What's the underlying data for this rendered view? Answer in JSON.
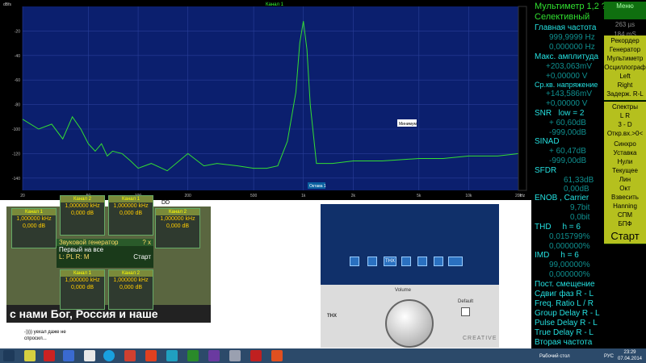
{
  "spectrum": {
    "title": "Канал 1",
    "corner_label": "dBfs",
    "y_ticks": [
      "-20",
      "-40",
      "-60",
      "-80",
      "-100",
      "-120",
      "-140"
    ],
    "x_ticks": [
      "20",
      "50",
      "100",
      "200",
      "500",
      "1k",
      "2k",
      "5k",
      "10k",
      "20k"
    ],
    "marker_label": "Минимум",
    "freq_label": "Октава 1",
    "axis_unit": "Hz"
  },
  "chart_data": {
    "type": "line",
    "xscale": "log",
    "xlim": [
      20,
      20000
    ],
    "ylim": [
      -150,
      0
    ],
    "ylabel": "dBfs",
    "x": [
      20,
      25,
      30,
      35,
      40,
      45,
      50,
      55,
      60,
      65,
      70,
      80,
      90,
      100,
      120,
      150,
      200,
      250,
      300,
      400,
      500,
      600,
      700,
      800,
      900,
      950,
      1000,
      1050,
      1100,
      1200,
      1500,
      2000,
      3000,
      5000,
      7000,
      10000,
      15000,
      20000
    ],
    "y": [
      -92,
      -100,
      -96,
      -108,
      -90,
      -100,
      -112,
      -118,
      -112,
      -122,
      -118,
      -120,
      -126,
      -132,
      -128,
      -134,
      -120,
      -130,
      -128,
      -130,
      -132,
      -132,
      -130,
      -110,
      -70,
      -30,
      -12,
      -35,
      -80,
      -128,
      -128,
      -126,
      -126,
      -124,
      -124,
      -122,
      -122,
      -120
    ]
  },
  "meter": {
    "title": "Мультиметр 1,2",
    "q": "?",
    "mode": "Селективный",
    "main_freq_label": "Главная частота",
    "main_freq_1": "999,9999 Hz",
    "main_freq_2": "0,000000 Hz",
    "max_amp_label": "Макс. амплитуда",
    "max_amp_1": "+203,063mV",
    "max_amp_2": "+0,00000 V",
    "rms_label": "Ср.кв. напряжение",
    "rms_1": "+143,586mV",
    "rms_2": "+0,00000 V",
    "snr_label": "SNR",
    "snr_low": "low = 2",
    "snr_1": "+ 60,60dB",
    "snr_2": "-999,00dB",
    "sinad_label": "SINAD",
    "sinad_1": "+ 60,47dB",
    "sinad_2": "-999,00dB",
    "sfdr_label": "SFDR",
    "sfdr_1": "61,33dB",
    "sfdr_2": "0,00dB",
    "enob_label": "ENOB , Carrier",
    "enob_1": "9,7bit",
    "enob_2": "0,0bit",
    "thd_label": "THD",
    "thd_h": "h = 6",
    "thd_1": "0,015799%",
    "thd_2": "0,000000%",
    "imd_label": "IMD",
    "imd_h": "h = 6",
    "imd_1": "99,00000%",
    "imd_2": "0,000000%",
    "dc_label": "Пост. смещение",
    "phase_label": "Сдвиг фаз R - L",
    "ratio_label": "Freq. Ratio  L / R",
    "group_label": "Group Delay R - L",
    "pulse_label": "Pulse Delay R - L",
    "true_label": "True Delay R - L",
    "second_label": "Вторая частота"
  },
  "side": {
    "menu": "Меню",
    "v1": "263 µs",
    "v2": "184 mS",
    "recorder": "Рекордер",
    "generator": "Генератор",
    "multimeter": "Мультиметр",
    "scope": "Осциллограф",
    "left": "Left",
    "right": "Right",
    "delay": "Задерж. R-L",
    "spectra": "Спектры",
    "lr": "L  R",
    "threed": "3 - D",
    "openin": "Откр.вх.>0<",
    "sync": "Синхро",
    "sync_val": "Уставка",
    "sync_val2": "Нули",
    "current": "Текущее",
    "lin": "Лин",
    "oct": "Окт",
    "weigh": "Взвесить",
    "hanning": "Hanning",
    "spm": "СПМ",
    "bpf": "БПФ",
    "start": "Старт"
  },
  "generator": {
    "wins": [
      {
        "title": "Канал 1",
        "v1": "1,000000 kHz",
        "v2": "0,000 dB"
      },
      {
        "title": "Канал 2",
        "v1": "1,000000 kHz",
        "v2": "0,000 dB"
      },
      {
        "title": "Канал 1",
        "v1": "1,000000 kHz",
        "v2": "0,000 dB"
      },
      {
        "title": "Канал 2",
        "v1": "1,000000 kHz",
        "v2": "0,000 dB"
      },
      {
        "title": "Канал 1",
        "v1": "1,000000 kHz",
        "v2": "0,000 dB"
      },
      {
        "title": "Канал 2",
        "v1": "1,000000 kHz",
        "v2": "0,000 dB"
      }
    ],
    "menu_title": "Звуковой генератор",
    "menu_q": "? x",
    "menu_first": "Первый на все",
    "menu_lr": "L: PL R: M",
    "menu_start": "Старт",
    "tag": "DD"
  },
  "banner": {
    "text": "с нами Бог, Россия и наше Братство"
  },
  "creative": {
    "volume": "Volume",
    "default": "Default",
    "brand": "CREATIVE",
    "thx": "THX"
  },
  "chat": {
    "line1": "-)))) уехал даже не",
    "line2": "спросил..."
  },
  "taskbar": {
    "desktop": "Рабочий стол",
    "lang": "РУС",
    "time": "23:29",
    "date": "07.04.2014"
  }
}
